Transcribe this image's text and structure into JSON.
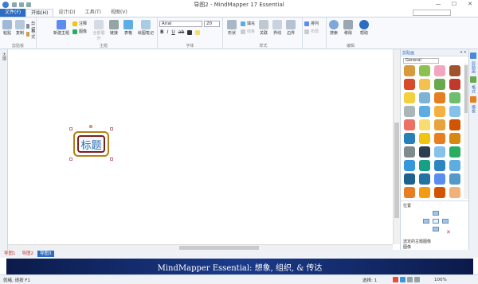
{
  "window": {
    "title": "导图2 - MindMapper 17 Essential",
    "minimize": "—",
    "maximize": "☐",
    "close": "✕"
  },
  "menu_tabs": [
    {
      "label": "文件(F)"
    },
    {
      "label": "开始(H)"
    },
    {
      "label": "设计(D)"
    },
    {
      "label": "工具(T)"
    },
    {
      "label": "视图(V)"
    }
  ],
  "ribbon": {
    "clipboard": {
      "paste": "粘贴",
      "copy": "复制",
      "cut": "剪切",
      "format": "格式",
      "group": "剪贴板"
    },
    "topic": {
      "new_topic": "新建主题",
      "note": "注释",
      "image": "图像",
      "expand": "全部展开",
      "link": "链接",
      "table": "表格",
      "draw_notes": "绘图笔记",
      "group": "主题"
    },
    "font": {
      "family": "Arial",
      "size": "20",
      "group": "字体",
      "bold": "B",
      "italic": "I",
      "underline": "U",
      "strike": "ab"
    },
    "style": {
      "shape": "形状",
      "fill": "填充",
      "line": "线条",
      "relation": "关联",
      "boundary": "界线",
      "branch": "边界",
      "group": "样式"
    },
    "arrange": {
      "sort": "排列",
      "map_layout": "布局",
      "group": ""
    },
    "edit": {
      "search": "搜索",
      "remove": "移除",
      "help": "帮助",
      "group": "编辑"
    }
  },
  "left_strip": {
    "label": "大纲"
  },
  "canvas": {
    "central_topic": "标题"
  },
  "doc_tabs": [
    {
      "label": "导图1"
    },
    {
      "label": "导图2"
    },
    {
      "label": "导图3"
    }
  ],
  "banner": {
    "text": "MindMapper Essential: 想象, 组织, & 传达"
  },
  "status": {
    "left": "就绪, 请按 F1",
    "right": "选择: 1",
    "zoom": "100%"
  },
  "panel": {
    "title": "剪贴画",
    "category": "General",
    "position_label": "位置",
    "footer_1": "选定的主题图像",
    "footer_2": "图像"
  },
  "right_strip": [
    {
      "label": "剪贴画"
    },
    {
      "label": "格式"
    },
    {
      "label": "模板"
    }
  ],
  "clipart_colors": [
    "#d89a3c",
    "#8cc152",
    "#f4a6c0",
    "#a0522d",
    "#d84b2a",
    "#f2c14e",
    "#6aa84f",
    "#c0392b",
    "#f4d03f",
    "#7fb3d5",
    "#e67e22",
    "#6dbf6d",
    "#aab7b8",
    "#5dade2",
    "#f5b041",
    "#85c1e9",
    "#ec7063",
    "#f7dc6f",
    "#e8a33d",
    "#d35400",
    "#2980b9",
    "#f1c40f",
    "#e67e22",
    "#d68910",
    "#7f8c8d",
    "#2c3e50",
    "#85c1e9",
    "#27ae60",
    "#3498db",
    "#16a085",
    "#2e86c1",
    "#5dade2",
    "#1f618d",
    "#2471a3",
    "#5b8def",
    "#5499c7",
    "#e67e22",
    "#f39c12",
    "#d35400",
    "#f0b27a",
    "#e59866",
    "#f5b041",
    "#ca6f1e",
    "#dc7633"
  ]
}
